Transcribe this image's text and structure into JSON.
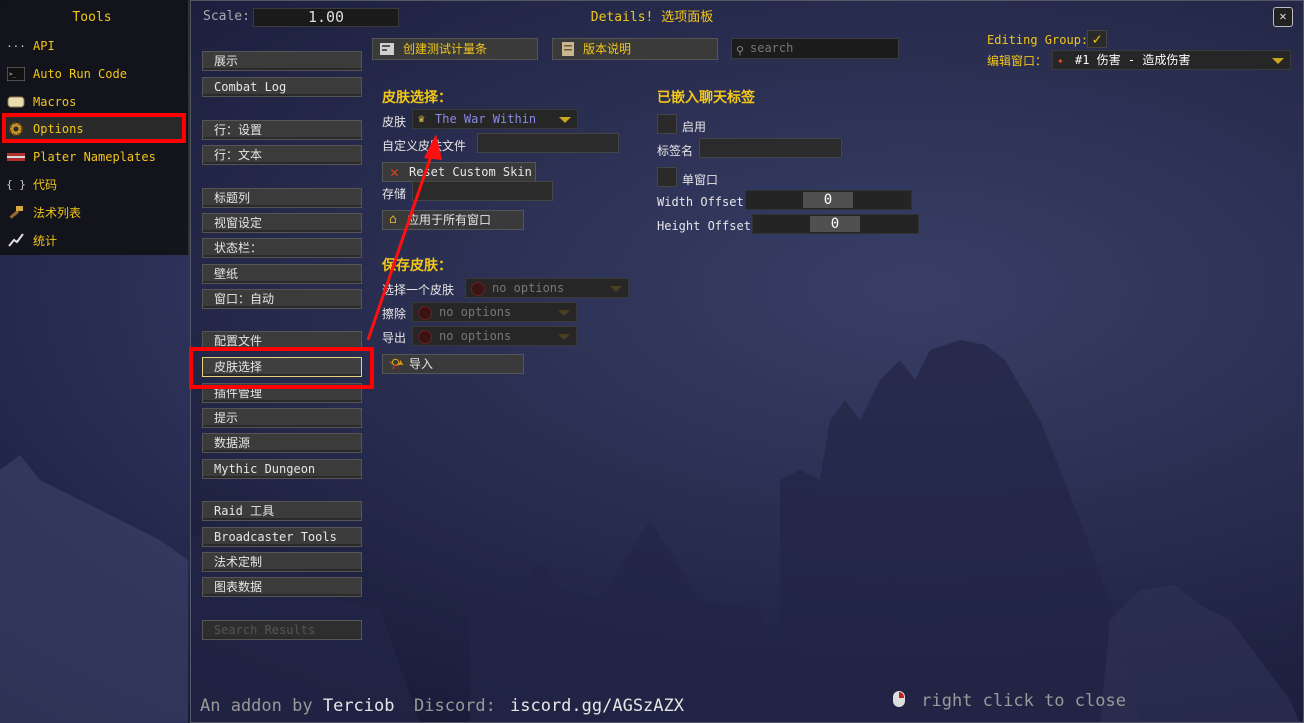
{
  "window": {
    "title": "Details! 选项面板",
    "close_glyph": "✕"
  },
  "scale": {
    "label": "Scale:",
    "value": "1.00"
  },
  "tools": {
    "title": "Tools",
    "items": [
      {
        "label": "API",
        "icon": "dots-icon"
      },
      {
        "label": "Auto Run Code",
        "icon": "terminal-icon"
      },
      {
        "label": "Macros",
        "icon": "scroll-icon"
      },
      {
        "label": "Options",
        "icon": "gear-icon"
      },
      {
        "label": "Plater Nameplates",
        "icon": "nameplate-icon"
      },
      {
        "label": "代码",
        "icon": "braces-icon"
      },
      {
        "label": "法术列表",
        "icon": "hammer-icon"
      },
      {
        "label": "统计",
        "icon": "chart-icon"
      }
    ]
  },
  "menu": {
    "items": [
      "展示",
      "Combat Log",
      "行：设置",
      "行：文本",
      "标题列",
      "视窗设定",
      "状态栏：",
      "壁纸",
      "窗口：自动",
      "配置文件",
      "皮肤选择",
      "插件管理",
      "提示",
      "数据源",
      "Mythic Dungeon",
      "Raid 工具",
      "Broadcaster Tools",
      "法术定制",
      "图表数据"
    ],
    "search_placeholder": "Search Results"
  },
  "toolbar": {
    "create_test_bars": "创建测试计量条",
    "version_notes": "版本说明",
    "search_placeholder": "search"
  },
  "editing": {
    "group_label": "Editing Group:",
    "group_checked": "✓",
    "window_label": "编辑窗口：",
    "window_value": "#1 伤害 - 造成伤害"
  },
  "skin": {
    "header": "皮肤选择：",
    "skin_label": "皮肤",
    "skin_value": "The War Within",
    "custom_label": "自定义皮肤文件",
    "reset_button": "Reset Custom Skin",
    "save_label": "存储",
    "apply_all_button": "应用于所有窗口"
  },
  "save_skin": {
    "header": "保存皮肤：",
    "select_label": "选择一个皮肤",
    "erase_label": "擦除",
    "export_label": "导出",
    "no_options": "no options",
    "import_button": "导入"
  },
  "chat_tab": {
    "header": "已嵌入聊天标签",
    "enable_label": "启用",
    "tab_name_label": "标签名",
    "single_window_label": "单窗口",
    "width_offset_label": "Width Offset",
    "width_offset_value": "0",
    "height_offset_label": "Height Offset",
    "height_offset_value": "0"
  },
  "footer": {
    "addon_by": "An addon by",
    "author": "Terciob",
    "discord_label": "Discord:",
    "discord_link": "iscord.gg/AGSzAZX",
    "right_click": "right click to close"
  },
  "colors": {
    "accent": "#f2c618",
    "highlight_box": "#ff0000",
    "skin_value": "#8a8ae8"
  }
}
